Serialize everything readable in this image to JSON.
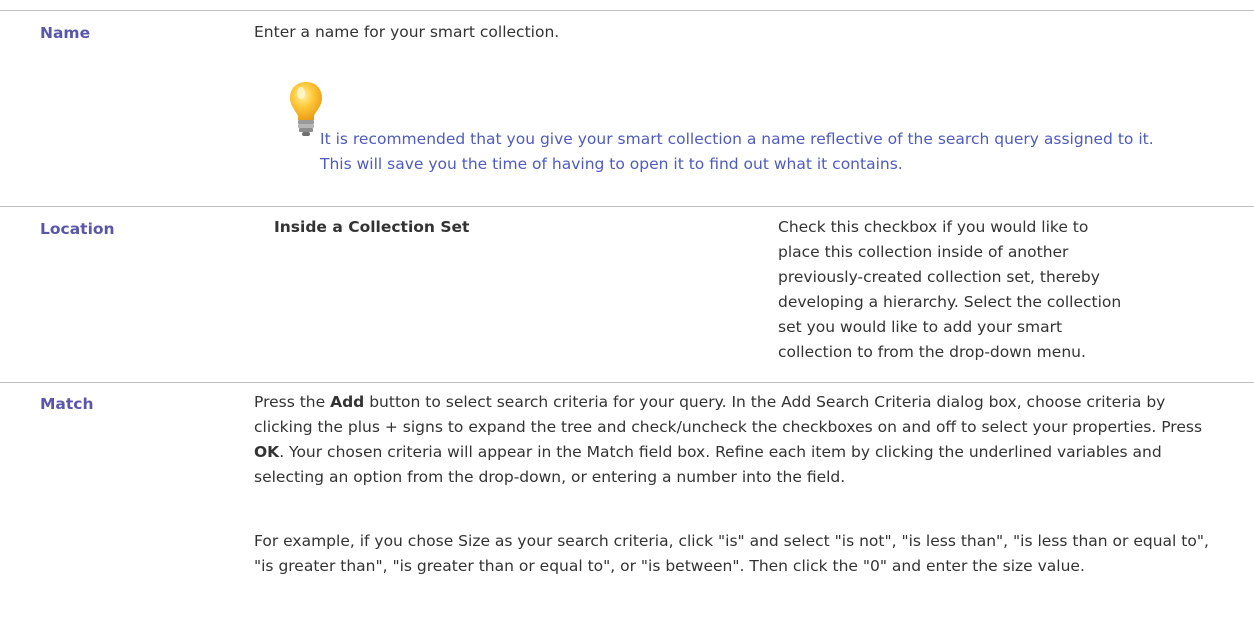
{
  "rows": {
    "name": {
      "term": "Name",
      "desc": "Enter a name for your smart collection.",
      "tip_icon": "lightbulb-icon",
      "tip": "It is recommended that you give your smart collection a name reflective of the search query assigned to it. This will save you the time of having to open it to find out what it contains."
    },
    "location": {
      "term": "Location",
      "option": "Inside a Collection Set",
      "desc": "Check this checkbox if you would like to place this collection inside of another previously-created collection set, thereby developing a hierarchy. Select the collection set you would like to add your smart collection to from the drop-down menu."
    },
    "match": {
      "term": "Match",
      "p1_a": "Press the ",
      "p1_add": "Add",
      "p1_b": " button to select search criteria for your query. In the Add Search Criteria dialog box, choose criteria by clicking the plus + signs to expand the tree and check/uncheck the checkboxes on and off to select your properties. Press ",
      "p1_ok": "OK",
      "p1_c": ". Your chosen criteria will appear in the Match field box. Refine each item by clicking the underlined variables and selecting an option from the drop-down, or entering a number into the field.",
      "p2": "For example, if you chose Size as your search criteria, click \"is\" and select \"is not\", \"is less than\", \"is less than or equal to\", \"is greater than\", \"is greater than or equal to\", or \"is between\". Then click the \"0\" and enter the size value."
    }
  },
  "colors": {
    "term": "#5b57a8",
    "tip": "#4f5bbf",
    "rule": "#bfbfbf"
  }
}
